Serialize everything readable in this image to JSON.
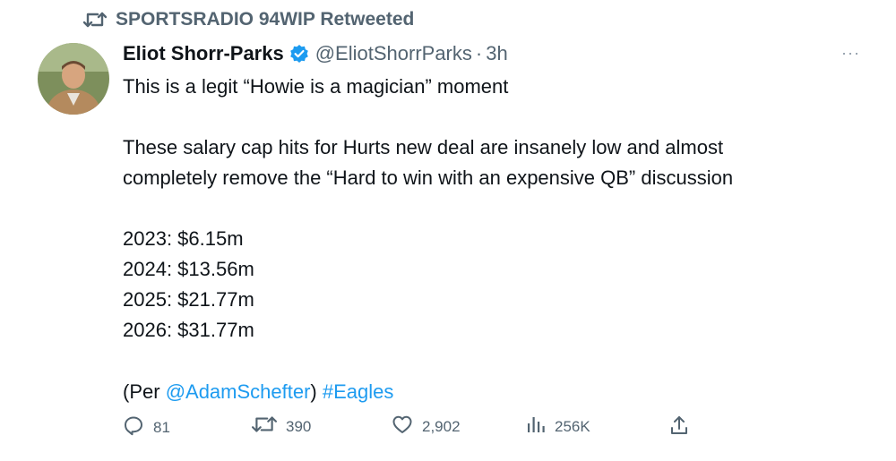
{
  "retweet": {
    "icon": "retweet-icon",
    "label": "SPORTSRADIO 94WIP Retweeted"
  },
  "tweet": {
    "author": {
      "display_name": "Eliot Shorr-Parks",
      "verified": true,
      "handle": "@EliotShorrParks",
      "separator": "·",
      "time": "3h"
    },
    "more_label": "···",
    "text": {
      "line1": "This is a legit “Howie is a magician” moment",
      "paragraph2_line1": "These salary cap hits for Hurts new deal are insanely low and almost",
      "paragraph2_line2": "completely remove the “Hard to win with an expensive QB” discussion",
      "cap_hits": [
        "2023: $6.15m",
        "2024: $13.56m",
        "2025: $21.77m",
        "2026: $31.77m"
      ],
      "per_open": "(Per ",
      "mention": "@AdamSchefter",
      "per_close": ") ",
      "hashtag": "#Eagles"
    },
    "actions": {
      "replies": "81",
      "retweets": "390",
      "likes": "2,902",
      "views": "256K"
    }
  },
  "colors": {
    "text": "#0f1419",
    "secondary": "#536471",
    "link": "#1d9bf0",
    "verified": "#1d9bf0"
  }
}
